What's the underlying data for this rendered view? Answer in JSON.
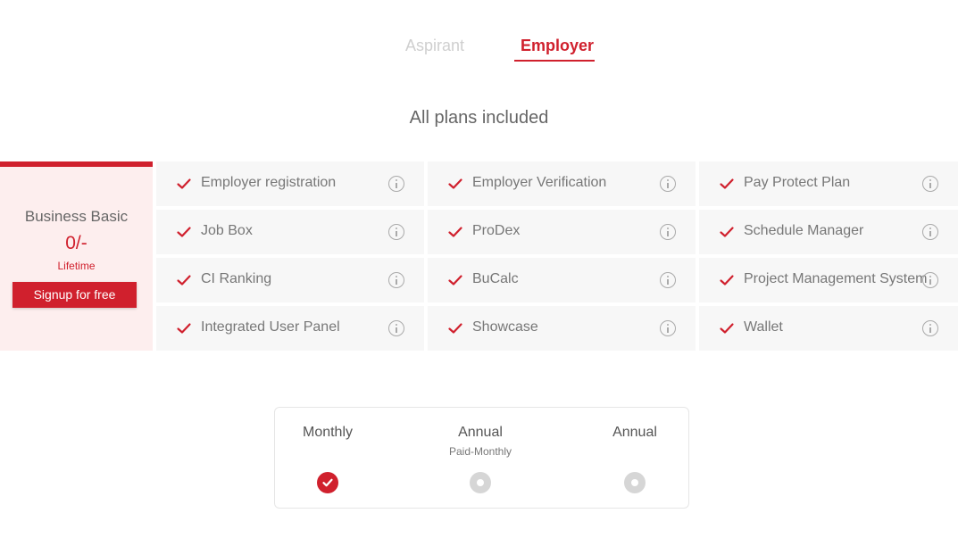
{
  "tabs": [
    {
      "label": "Aspirant",
      "active": false
    },
    {
      "label": "Employer",
      "active": true
    }
  ],
  "heading": "All plans included",
  "plan": {
    "name": "Business Basic",
    "price": "0/-",
    "period": "Lifetime",
    "cta": "Signup for free"
  },
  "features": [
    [
      "Employer registration",
      "Employer Verification",
      "Pay Protect Plan"
    ],
    [
      "Job Box",
      "ProDex",
      "Schedule Manager"
    ],
    [
      "CI Ranking",
      "BuCalc",
      "Project Management System"
    ],
    [
      "Integrated User Panel",
      "Showcase",
      "Wallet"
    ]
  ],
  "billing": [
    {
      "title": "Monthly",
      "subtitle": "",
      "selected": true
    },
    {
      "title": "Annual",
      "subtitle": "Paid-Monthly",
      "selected": false
    },
    {
      "title": "Annual",
      "subtitle": "",
      "selected": false
    }
  ],
  "icons": {
    "check": "check-icon",
    "info": "info-icon",
    "radio_selected": "check-circle-icon"
  },
  "colors": {
    "accent": "#d0202d",
    "plan_bg": "#fdeeee",
    "feature_bg": "#f7f7f7",
    "inactive_tab": "#cfcfcf"
  }
}
